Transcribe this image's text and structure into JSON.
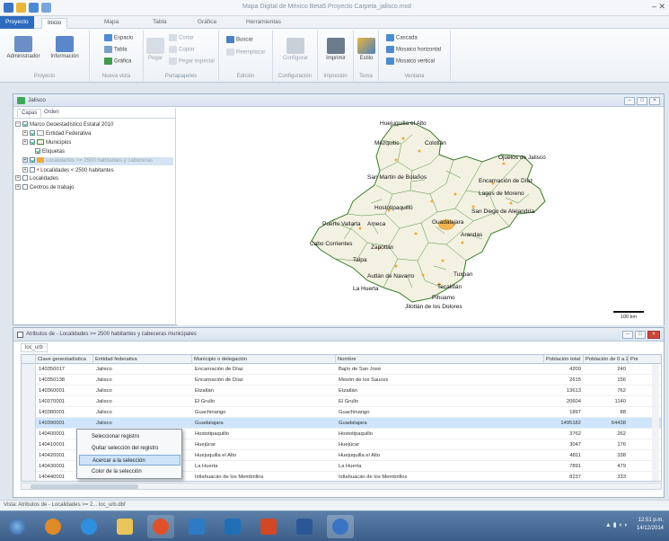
{
  "window": {
    "title": "Mapa Digital de México Beta5  Proyecto Carpeta_jalisco.mxd"
  },
  "ribbon_tabs": [
    "Proyecto",
    "Inicio",
    "Mapa",
    "Tabla",
    "Gráfica",
    "Herramientas"
  ],
  "ribbon": {
    "groups": [
      {
        "label": "Proyecto",
        "buttons": [
          "Administrador",
          "Información"
        ]
      },
      {
        "label": "Nueva vista",
        "buttons": [
          "Espacio",
          "Tabla",
          "Gráfica"
        ]
      },
      {
        "label": "Portapapeles",
        "buttons": [
          "Pegar",
          "Cortar",
          "Copiar",
          "Pegar especial"
        ]
      },
      {
        "label": "Edición",
        "buttons": [
          "Buscar",
          "Reemplazar"
        ]
      },
      {
        "label": "Configuración",
        "buttons": [
          "Configurar"
        ]
      },
      {
        "label": "Impresión",
        "buttons": [
          "Imprimir"
        ]
      },
      {
        "label": "Tema",
        "buttons": [
          "Estilo"
        ]
      },
      {
        "label": "Ventana",
        "buttons": [
          "Cascada",
          "Mosaico horizontal",
          "Mosaico vertical"
        ]
      }
    ]
  },
  "map_window": {
    "title": "Jalisco",
    "panel_tabs": [
      "Capas",
      "Orden"
    ],
    "layers": [
      {
        "label": "Marco Geoestadístico Estatal 2010",
        "checked": true
      },
      {
        "label": "Entidad Federativa",
        "checked": true
      },
      {
        "label": "Municipios",
        "checked": true
      },
      {
        "label": "Etiquetas",
        "checked": true
      },
      {
        "label": "Localidades >= 2500 habitantes y cabeceras",
        "checked": true
      },
      {
        "label": "Localidades < 2500 habitantes",
        "checked": false
      },
      {
        "label": "Localidades",
        "checked": false
      },
      {
        "label": "Centros de trabajo",
        "checked": false
      }
    ],
    "map_labels": [
      "Huejuquilla el Alto",
      "Mezquitic",
      "Colotlán",
      "San Martín de Bolaños",
      "Ojuelos de Jalisco",
      "Encarnación de Díaz",
      "Lagos de Moreno",
      "Hostotipaquillo",
      "San Diego de Alejandría",
      "Puerto Vallarta",
      "Ameca",
      "Guadalajara",
      "Arandas",
      "Cabo Corrientes",
      "Zapotlán",
      "Talpa",
      "Autlán de Navarro",
      "Tuxpan",
      "La Huerta",
      "Tecalitlán",
      "Pihuamo",
      "Jilotlán de los Dolores"
    ],
    "scale": "100 km"
  },
  "attr_window": {
    "title": "Atributos de - Localidades >= 2500 habitantes y cabeceras municipales",
    "tab": "loc_urb",
    "columns": [
      "Clave geoestadística",
      "Entidad federativa",
      "Municipio o delegación",
      "Nombre",
      "Población total",
      "Población de 0 a 2 años",
      "Por"
    ],
    "rows": [
      [
        "140350017",
        "Jalisco",
        "Encarnación de Díaz",
        "Bajío de San José",
        "4209",
        "240",
        ""
      ],
      [
        "140350138",
        "Jalisco",
        "Encarnación de Díaz",
        "Mesón de los Sauces",
        "2615",
        "156",
        ""
      ],
      [
        "140360001",
        "Jalisco",
        "Etzatlán",
        "Etzatlán",
        "13613",
        "762",
        ""
      ],
      [
        "140370001",
        "Jalisco",
        "El Grullo",
        "El Grullo",
        "20604",
        "1140",
        ""
      ],
      [
        "140380001",
        "Jalisco",
        "Guachinango",
        "Guachinango",
        "1897",
        "88",
        ""
      ],
      [
        "140390001",
        "Jalisco",
        "Guadalajara",
        "Guadalajara",
        "1495182",
        "64438",
        ""
      ],
      [
        "140400001",
        "Jalisco",
        "Hostotipaquillo",
        "Hostotipaquillo",
        "3762",
        "262",
        ""
      ],
      [
        "140410001",
        "Jalisco",
        "Huejúcar",
        "Huejúcar",
        "3047",
        "176",
        ""
      ],
      [
        "140420001",
        "Jalisco",
        "Huejuquilla el Alto",
        "Huejuquilla el Alto",
        "4811",
        "338",
        ""
      ],
      [
        "140430001",
        "Jalisco",
        "La Huerta",
        "La Huerta",
        "7891",
        "479",
        ""
      ],
      [
        "140440001",
        "Jalisco",
        "Ixtlahuacán de los Membrillos",
        "Ixtlahuacán de los Membrillos",
        "8237",
        "333",
        ""
      ]
    ],
    "selected_row": 5
  },
  "context_menu": {
    "items": [
      "Seleccionar registro",
      "Quitar selección del registro",
      "Acercar a la selección",
      "Color de la selección"
    ],
    "highlighted": 2
  },
  "status": {
    "text": "Vista: Atributos de - Localidades >= 2...   loc_urb.dbf"
  },
  "taskbar": {
    "clock_time": "12:51 p.m.",
    "clock_date": "14/12/2014"
  }
}
